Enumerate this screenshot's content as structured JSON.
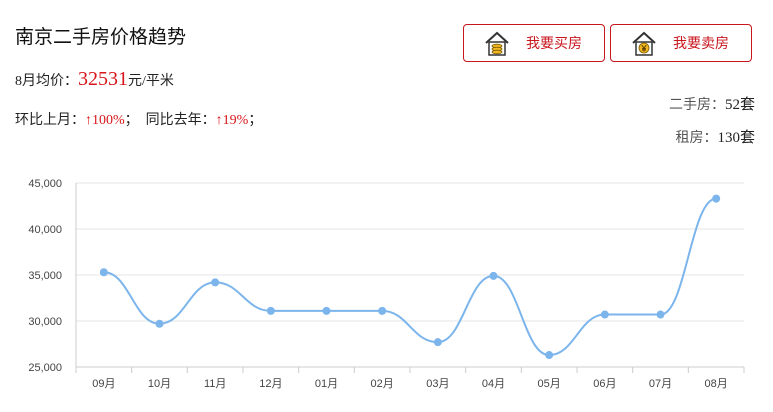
{
  "header": {
    "title": "南京二手房价格趋势"
  },
  "average": {
    "prefix": "8月均价：",
    "value": "32531",
    "unit": "元/平米"
  },
  "comparison": {
    "mom_label": "环比上月：",
    "mom_arrow": "↑",
    "mom_value": "100%",
    "mom_sep": "；",
    "yoy_label": "同比去年：",
    "yoy_arrow": "↑",
    "yoy_value": "19%",
    "yoy_sep": "；"
  },
  "buttons": {
    "buy": {
      "label": "我要买房",
      "icon": "house-coins-icon"
    },
    "sell": {
      "label": "我要卖房",
      "icon": "house-yen-icon"
    }
  },
  "stats": {
    "second_hand": {
      "label": "二手房：",
      "value": "52套"
    },
    "rental": {
      "label": "租房：",
      "value": "130套"
    }
  },
  "colors": {
    "accent": "#c8161d",
    "price_red": "#d9161b",
    "line": "#7cb5ec"
  },
  "chart_data": {
    "type": "line",
    "categories": [
      "09月",
      "10月",
      "11月",
      "12月",
      "01月",
      "02月",
      "03月",
      "04月",
      "05月",
      "06月",
      "07月",
      "08月"
    ],
    "series": [
      {
        "values": [
          35300,
          29700,
          34200,
          31100,
          31100,
          31100,
          27700,
          34900,
          26300,
          30700,
          30700,
          43300
        ]
      }
    ],
    "ylim": [
      25000,
      45000
    ],
    "yticks": [
      "25,000",
      "30,000",
      "35,000",
      "40,000",
      "45,000"
    ],
    "grid": true,
    "smooth": true
  }
}
